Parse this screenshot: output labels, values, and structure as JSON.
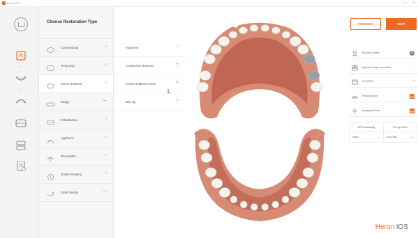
{
  "window": {
    "title": "Heron IOS",
    "min": "—",
    "close": "×"
  },
  "rail": {
    "home_icon": "home-icon",
    "items": [
      "scan-icon",
      "lower-jaw-icon",
      "upper-jaw-icon",
      "both-jaws-icon",
      "bite-icon",
      "order-form-icon"
    ]
  },
  "menu": {
    "header": "Choose Restoration Type",
    "items": [
      {
        "label": "Conventional",
        "icon": "crown-icon",
        "arrow": "›"
      },
      {
        "label": "Temporary",
        "icon": "temporary-icon",
        "arrow": "›"
      },
      {
        "label": "Screw Retained",
        "icon": "screw-retained-icon",
        "arrow": "›"
      },
      {
        "label": "Bridge",
        "icon": "bridge-icon",
        "arrow": "—"
      },
      {
        "label": "Orthodontics",
        "icon": "orthodontics-icon",
        "arrow": "›"
      },
      {
        "label": "Appliance",
        "icon": "appliance-icon",
        "arrow": "›"
      },
      {
        "label": "Removable",
        "icon": "removable-icon",
        "arrow": "›"
      },
      {
        "label": "Guided Surgery",
        "icon": "guided-surgery-icon",
        "arrow": "›"
      },
      {
        "label": "Smile Design",
        "icon": "smile-design-icon",
        "arrow": "—"
      }
    ]
  },
  "submenu": {
    "items": [
      {
        "label": "Abutment",
        "arrow": "›"
      },
      {
        "label": "Anatomical Abutment",
        "arrow": "+"
      },
      {
        "label": "Screw Retained Crown",
        "arrow": "+"
      },
      {
        "label": "Bite Up",
        "arrow": "+"
      }
    ]
  },
  "panel": {
    "prev_label": "PREVIOUS",
    "next_label": "NEXT",
    "options": [
      {
        "label": "Full Arch Install",
        "icon": "user-icon",
        "control": "clear"
      },
      {
        "label": "Hydrated Gap Kameo.Ext",
        "icon": "tooth-group-icon",
        "control": "dropdown"
      },
      {
        "label": "9/14/2021",
        "icon": "calendar-icon",
        "control": "chevron"
      },
      {
        "label": "Printed Model",
        "icon": "model-icon",
        "control": "checked"
      },
      {
        "label": "Antagonist Scan",
        "icon": "antagonist-icon",
        "control": "checked"
      }
    ],
    "table": {
      "head": [
        "3D Processing",
        "Pre-op Scan"
      ],
      "values": [
        "None",
        "Scan Bite"
      ]
    }
  },
  "brand": {
    "part1": "Heron",
    "part2": " IOS"
  },
  "colors": {
    "accent": "#ec6a24",
    "gum": "#b85a4a",
    "gum_light": "#d78b74",
    "tooth": "#f6f3ec",
    "tooth_selected": "#9aa0a6"
  }
}
